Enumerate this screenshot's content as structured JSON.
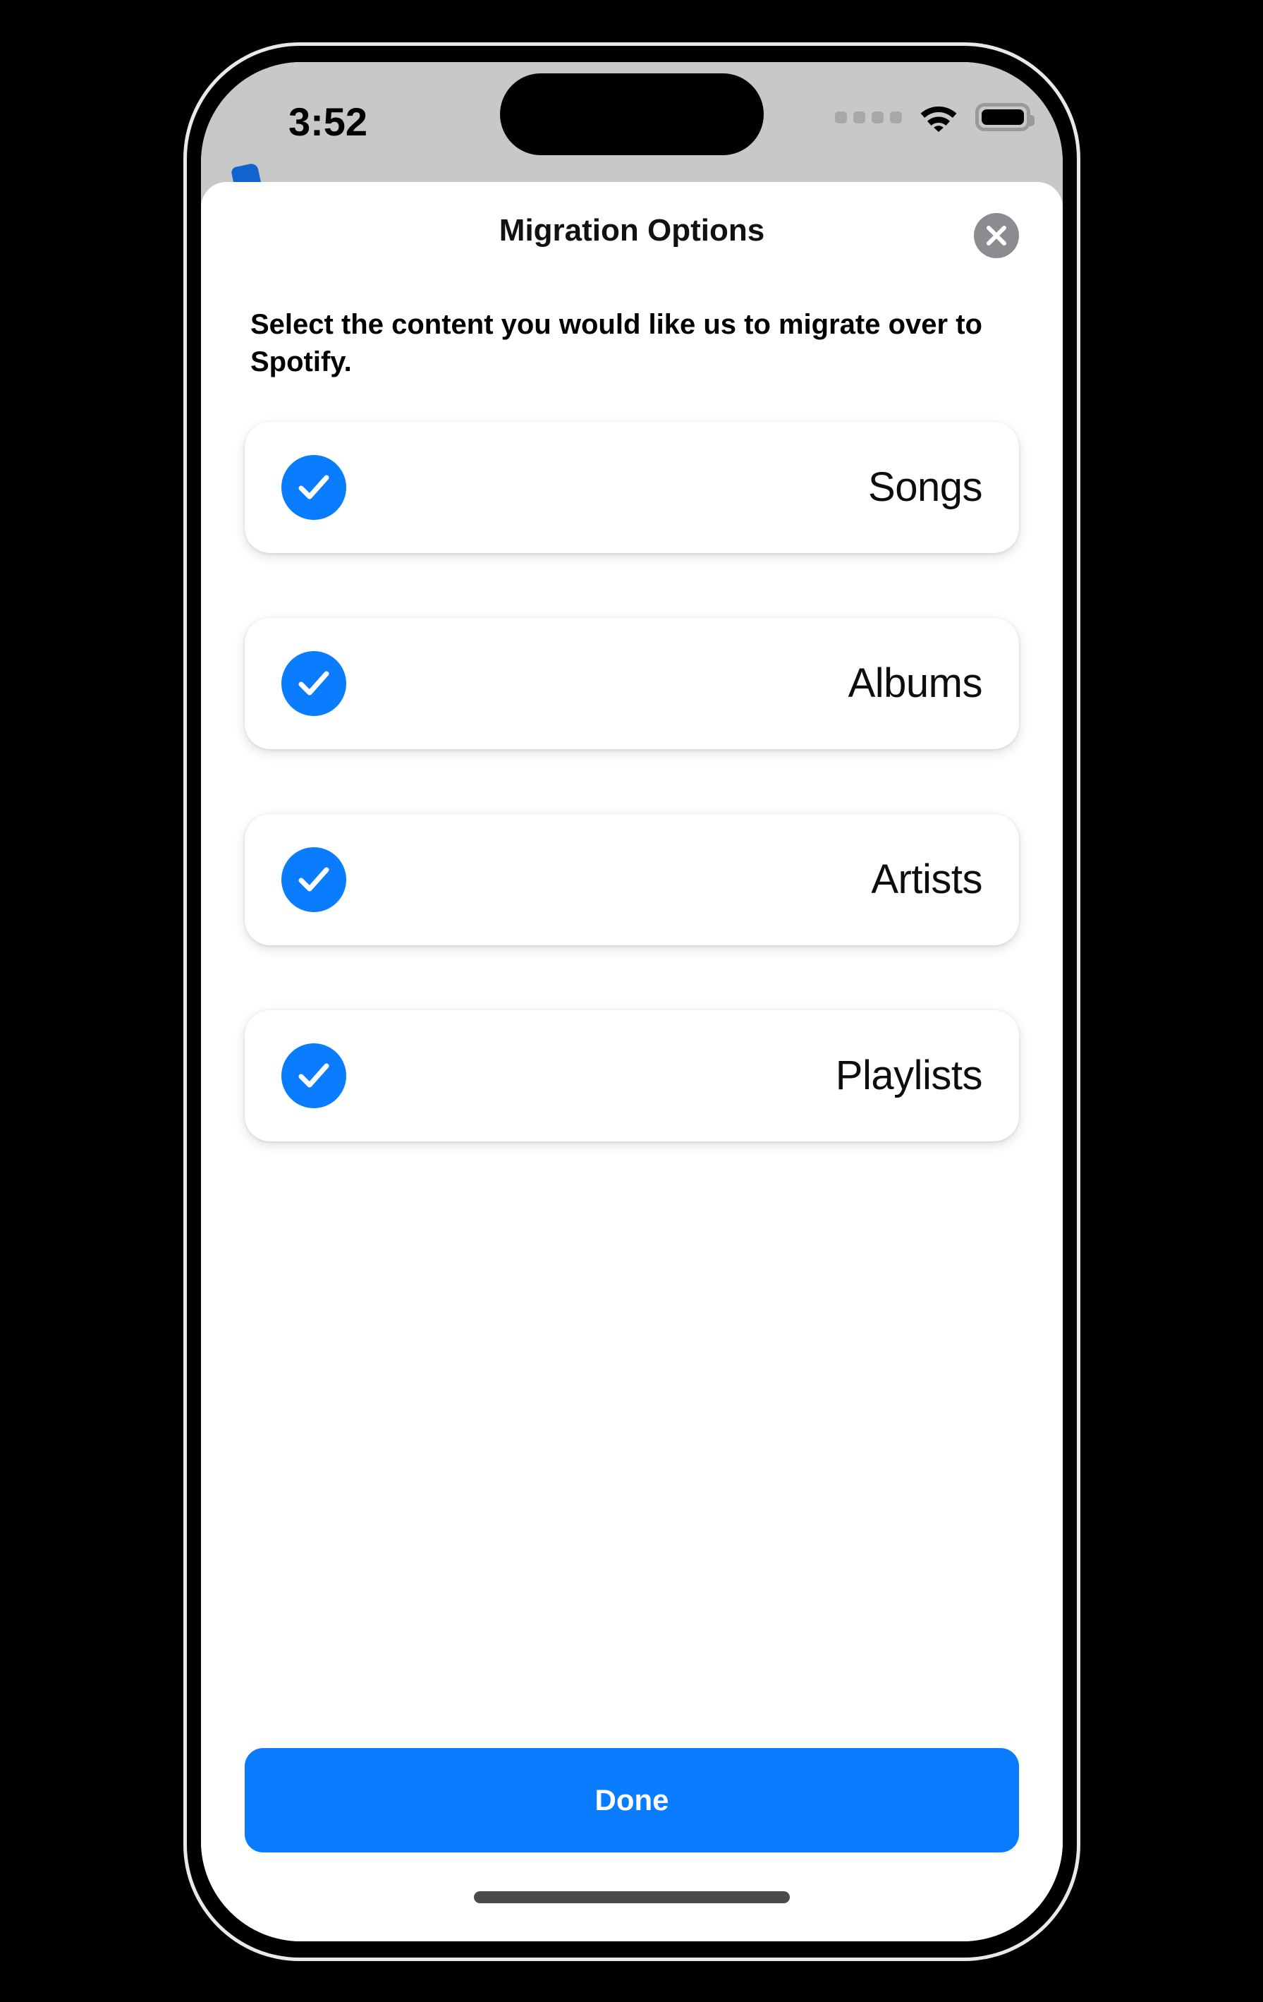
{
  "status_bar": {
    "time": "3:52",
    "cellular_icon": "cellular-dots-icon",
    "wifi_icon": "wifi-icon",
    "battery_icon": "battery-full-icon"
  },
  "modal": {
    "title": "Migration Options",
    "close_icon": "close-icon",
    "subtitle": "Select the content you would like us to migrate over to Spotify.",
    "options": [
      {
        "label": "Songs",
        "checked": true,
        "icon": "checkmark-icon"
      },
      {
        "label": "Albums",
        "checked": true,
        "icon": "checkmark-icon"
      },
      {
        "label": "Artists",
        "checked": true,
        "icon": "checkmark-icon"
      },
      {
        "label": "Playlists",
        "checked": true,
        "icon": "checkmark-icon"
      }
    ],
    "primary_button": "Done"
  },
  "colors": {
    "accent_blue": "#0a7cff",
    "close_gray": "#8a8c8f",
    "sheet_white": "#ffffff",
    "screen_bg": "#c4c4c4",
    "home_indicator": "#4a4a4a"
  }
}
